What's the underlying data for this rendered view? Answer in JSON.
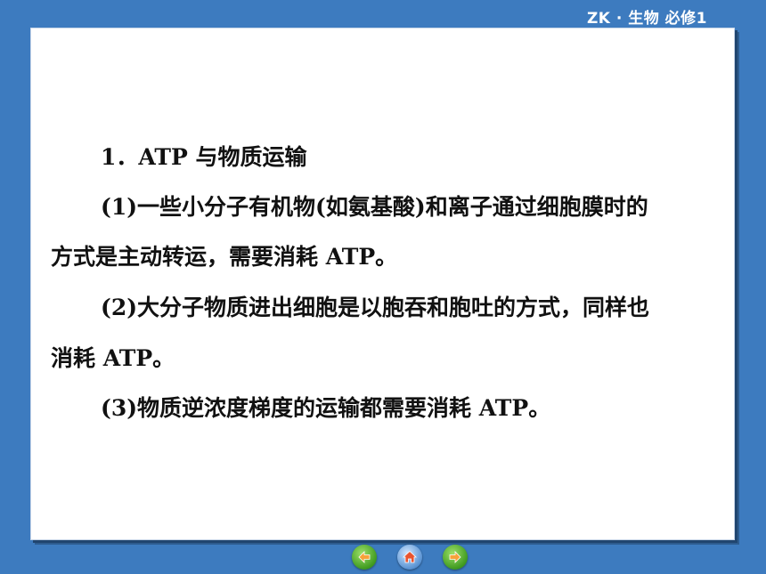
{
  "header": {
    "label": "ZK · 生物   必修1"
  },
  "content": {
    "heading": "1．ATP 与物质运输",
    "p1_line1": "(1)一些小分子有机物(如氨基酸)和离子通过细胞膜时的",
    "p1_line2": "方式是主动转运，需要消耗 ATP。",
    "p2_line1": "(2)大分子物质进出细胞是以胞吞和胞吐的方式，同样也",
    "p2_line2": "消耗 ATP。",
    "p3_line1": "(3)物质逆浓度梯度的运输都需要消耗 ATP。"
  },
  "nav": {
    "prev_icon": "prev-arrow-icon",
    "home_icon": "home-icon",
    "next_icon": "next-arrow-icon",
    "green": "#3f9a1f",
    "blue": "#5a93d3"
  },
  "colors": {
    "background": "#3d7bbf",
    "card": "#ffffff",
    "text": "#111111"
  }
}
